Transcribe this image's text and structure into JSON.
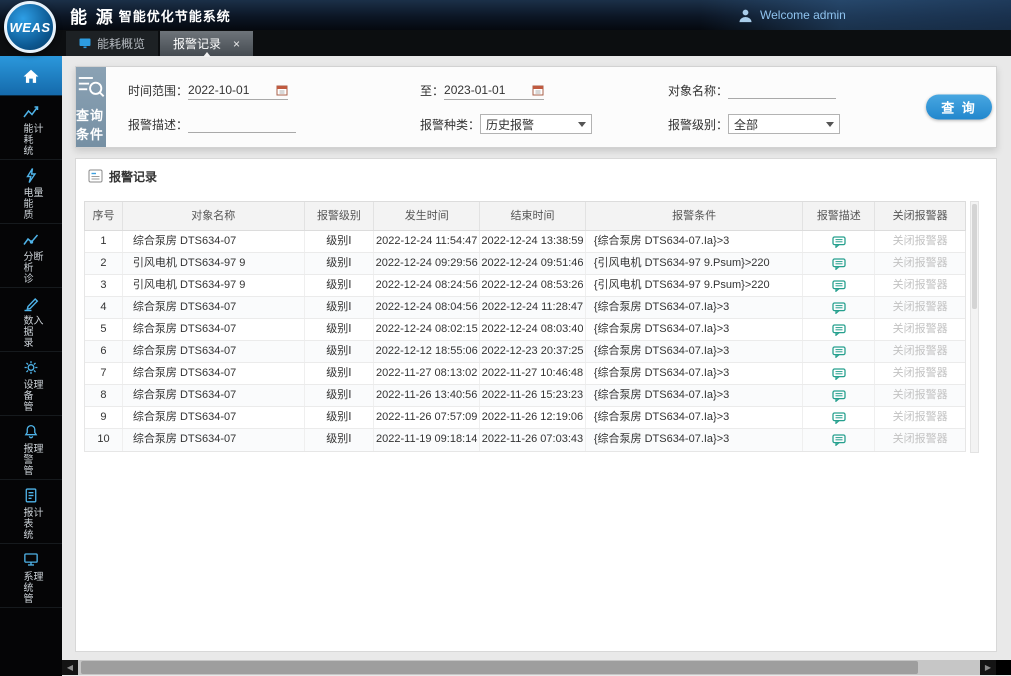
{
  "app": {
    "brand": "WEAS",
    "title_main": "能 源",
    "title_sub": "智能优化节能系统",
    "welcome": "Welcome admin"
  },
  "tabs": [
    {
      "label": "能耗概览"
    },
    {
      "label": "报警记录",
      "close": "×"
    }
  ],
  "sidebar": {
    "items": [
      {
        "label": "能耗统计"
      },
      {
        "label": "电能质量"
      },
      {
        "label": "分析诊断"
      },
      {
        "label": "数据录入"
      },
      {
        "label": "设备管理"
      },
      {
        "label": "报警管理"
      },
      {
        "label": "报表统计"
      },
      {
        "label": "系统管理"
      }
    ]
  },
  "query": {
    "panel_label": "查询条件",
    "time_range_label": "时间范围：",
    "time_from": "2022-10-01",
    "to_label": "至：",
    "time_to": "2023-01-01",
    "object_label": "对象名称：",
    "object_value": "",
    "desc_label": "报警描述：",
    "desc_value": "",
    "type_label": "报警种类：",
    "type_value": "历史报警",
    "level_label": "报警级别：",
    "level_value": "全部",
    "search_label": "查 询"
  },
  "records": {
    "section_title": "报警记录",
    "columns": [
      "序号",
      "对象名称",
      "报警级别",
      "发生时间",
      "结束时间",
      "报警条件",
      "报警描述",
      "关闭报警器"
    ],
    "close_action": "关闭报警器",
    "rows": [
      {
        "no": "1",
        "object": "综合泵房 DTS634-07",
        "level": "级别Ⅰ",
        "start": "2022-12-24 11:54:47",
        "end": "2022-12-24 13:38:59",
        "condition": "{综合泵房 DTS634-07.Ia}>3"
      },
      {
        "no": "2",
        "object": "引风电机 DTS634-97 9",
        "level": "级别Ⅰ",
        "start": "2022-12-24 09:29:56",
        "end": "2022-12-24 09:51:46",
        "condition": "{引风电机 DTS634-97 9.Psum}>220"
      },
      {
        "no": "3",
        "object": "引风电机 DTS634-97 9",
        "level": "级别Ⅰ",
        "start": "2022-12-24 08:24:56",
        "end": "2022-12-24 08:53:26",
        "condition": "{引风电机 DTS634-97 9.Psum}>220"
      },
      {
        "no": "4",
        "object": "综合泵房 DTS634-07",
        "level": "级别Ⅰ",
        "start": "2022-12-24 08:04:56",
        "end": "2022-12-24 11:28:47",
        "condition": "{综合泵房 DTS634-07.Ia}>3"
      },
      {
        "no": "5",
        "object": "综合泵房 DTS634-07",
        "level": "级别Ⅰ",
        "start": "2022-12-24 08:02:15",
        "end": "2022-12-24 08:03:40",
        "condition": "{综合泵房 DTS634-07.Ia}>3"
      },
      {
        "no": "6",
        "object": "综合泵房 DTS634-07",
        "level": "级别Ⅰ",
        "start": "2022-12-12 18:55:06",
        "end": "2022-12-23 20:37:25",
        "condition": "{综合泵房 DTS634-07.Ia}>3"
      },
      {
        "no": "7",
        "object": "综合泵房 DTS634-07",
        "level": "级别Ⅰ",
        "start": "2022-11-27 08:13:02",
        "end": "2022-11-27 10:46:48",
        "condition": "{综合泵房 DTS634-07.Ia}>3"
      },
      {
        "no": "8",
        "object": "综合泵房 DTS634-07",
        "level": "级别Ⅰ",
        "start": "2022-11-26 13:40:56",
        "end": "2022-11-26 15:23:23",
        "condition": "{综合泵房 DTS634-07.Ia}>3"
      },
      {
        "no": "9",
        "object": "综合泵房 DTS634-07",
        "level": "级别Ⅰ",
        "start": "2022-11-26 07:57:09",
        "end": "2022-11-26 12:19:06",
        "condition": "{综合泵房 DTS634-07.Ia}>3"
      },
      {
        "no": "10",
        "object": "综合泵房 DTS634-07",
        "level": "级别Ⅰ",
        "start": "2022-11-19 09:18:14",
        "end": "2022-11-26 07:03:43",
        "condition": "{综合泵房 DTS634-07.Ia}>3"
      }
    ]
  },
  "icons": {
    "scroll_left": "◀",
    "scroll_right": "▶"
  }
}
